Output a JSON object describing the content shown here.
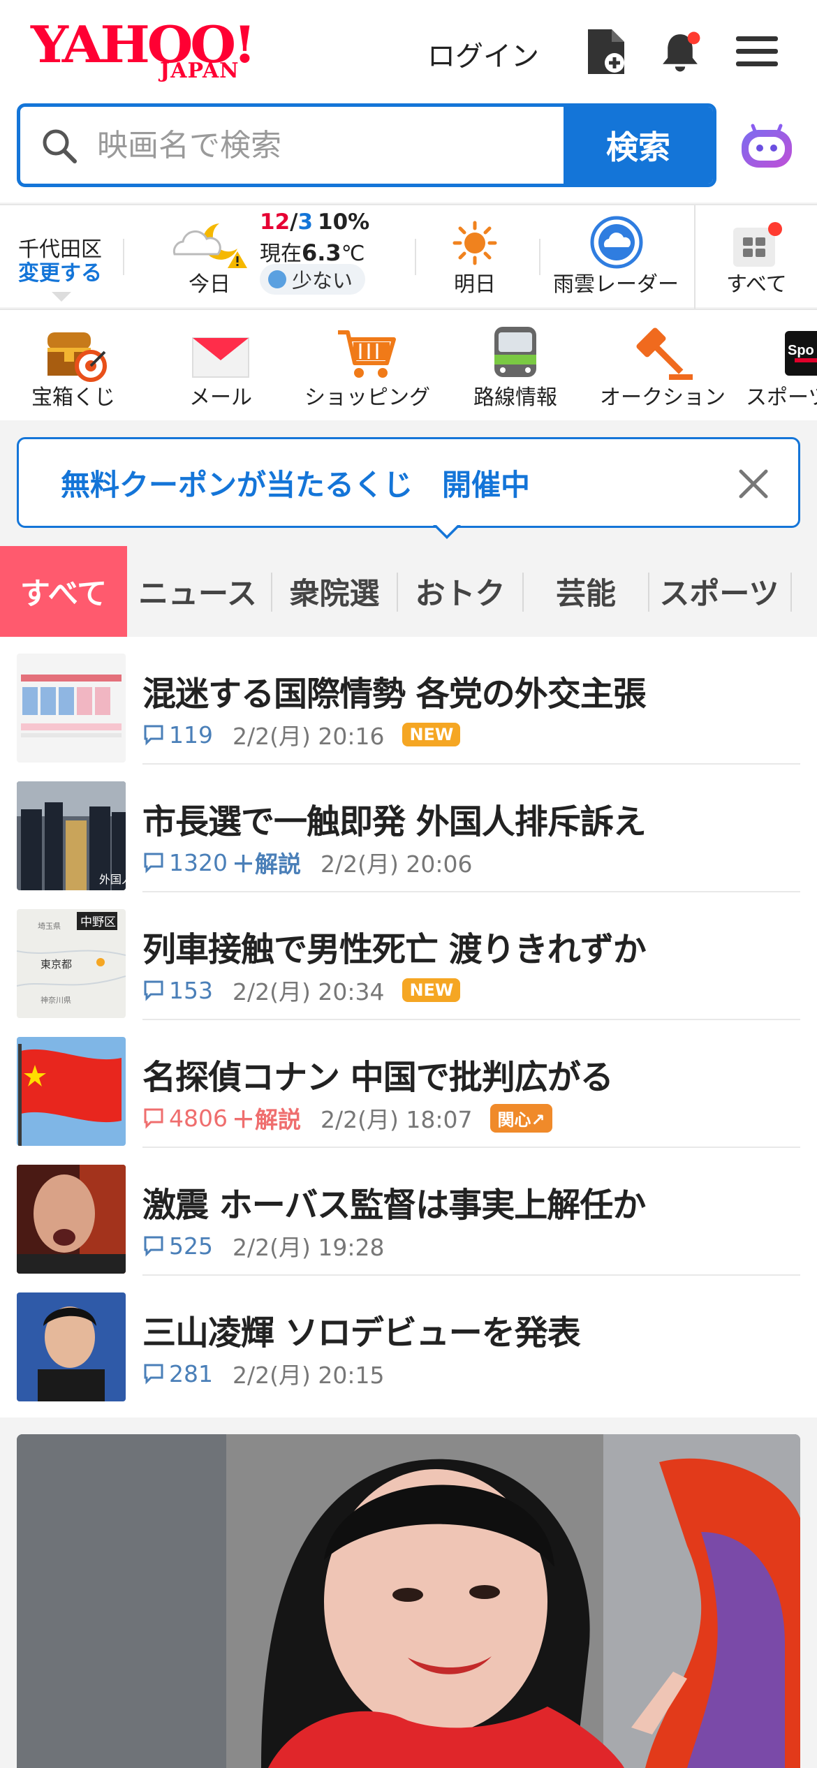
{
  "header": {
    "logo_main": "YAHOO!",
    "logo_sub": "JAPAN",
    "login_label": "ログイン",
    "search_placeholder": "映画名で検索",
    "search_button": "検索"
  },
  "weather": {
    "location": "千代田区",
    "change_label": "変更する",
    "today_label": "今日",
    "temp_high": "12",
    "temp_sep": "/",
    "temp_low": "3",
    "rain_chance": "10%",
    "now_prefix": "現在",
    "now_temp": "6.3",
    "now_unit": "℃",
    "pollen": "少ない",
    "tomorrow_label": "明日",
    "radar_label": "雨雲レーダー",
    "all_label": "すべて"
  },
  "services": [
    {
      "label": "宝箱くじ"
    },
    {
      "label": "メール"
    },
    {
      "label": "ショッピング"
    },
    {
      "label": "路線情報"
    },
    {
      "label": "オークション"
    },
    {
      "label": "スポーツ"
    }
  ],
  "banner": {
    "text": "無料クーポンが当たるくじ　開催中"
  },
  "tabs": [
    "すべて",
    "ニュース",
    "衆院選",
    "おトク",
    "芸能",
    "スポーツ"
  ],
  "news": [
    {
      "title": "混迷する国際情勢 各党の外交主張",
      "comments": "119",
      "kaisetsu": "",
      "date": "2/2(月) 20:16",
      "badge": "NEW"
    },
    {
      "title": "市長選で一触即発 外国人排斥訴え",
      "comments": "1320",
      "kaisetsu": "＋解説",
      "date": "2/2(月) 20:06",
      "badge": ""
    },
    {
      "title": "列車接触で男性死亡 渡りきれずか",
      "comments": "153",
      "kaisetsu": "",
      "date": "2/2(月) 20:34",
      "badge": "NEW"
    },
    {
      "title": "名探偵コナン 中国で批判広がる",
      "comments": "4806",
      "kaisetsu": "＋解説",
      "date": "2/2(月) 18:07",
      "badge": "関心↗"
    },
    {
      "title": "激震 ホーバス監督は事実上解任か",
      "comments": "525",
      "kaisetsu": "",
      "date": "2/2(月) 19:28",
      "badge": ""
    },
    {
      "title": "三山凌輝 ソロデビューを発表",
      "comments": "281",
      "kaisetsu": "",
      "date": "2/2(月) 20:15",
      "badge": ""
    }
  ],
  "thumb_labels": {
    "map_area": "中野区",
    "map_city": "東京都",
    "map_pref1": "埼玉県",
    "map_pref2": "神奈川県",
    "flag_caption": "外国人"
  },
  "colors": {
    "brand_red": "#ff0033",
    "accent_blue": "#1475d8",
    "active_tab": "#ff5a6e",
    "new_badge": "#f5a623"
  }
}
